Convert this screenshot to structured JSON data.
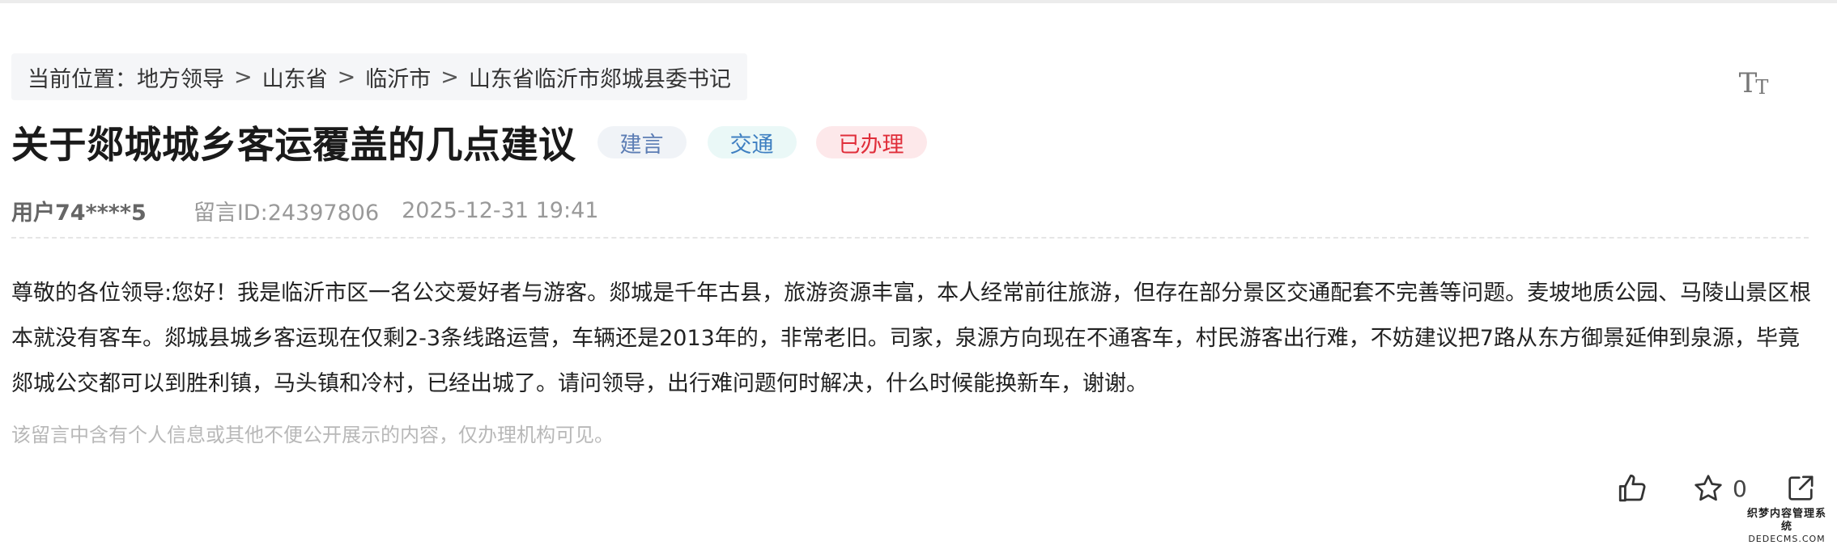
{
  "breadcrumb": {
    "prefix": "当前位置：",
    "items": [
      "地方领导",
      "山东省",
      "临沂市",
      "山东省临沂市郯城县委书记"
    ],
    "separator": ">"
  },
  "toolbar": {
    "font_size_icon": "font-size-icon",
    "font_size_big": "T",
    "font_size_small": "T"
  },
  "message": {
    "title": "关于郯城城乡客运覆盖的几点建议",
    "tags": {
      "type": "建言",
      "category": "交通",
      "status": "已办理"
    },
    "user": "用户74****5",
    "id_label": "留言ID:24397806",
    "datetime": "2025-12-31 19:41",
    "content": "尊敬的各位领导:您好！我是临沂市区一名公交爱好者与游客。郯城是千年古县，旅游资源丰富，本人经常前往旅游，但存在部分景区交通配套不完善等问题。麦坡地质公园、马陵山景区根本就没有客车。郯城县城乡客运现在仅剩2-3条线路运营，车辆还是2013年的，非常老旧。司家，泉源方向现在不通客车，村民游客出行难，不妨建议把7路从东方御景延伸到泉源，毕竟郯城公交都可以到胜利镇，马头镇和冷村，已经出城了。请问领导，出行难问题何时解决，什么时候能换新车，谢谢。",
    "privacy_notice": "该留言中含有个人信息或其他不便公开展示的内容，仅办理机构可见。"
  },
  "actions": {
    "like_icon": "thumbs-up-icon",
    "favorite_icon": "star-icon",
    "favorite_count": "0",
    "share_icon": "share-icon"
  },
  "watermark": {
    "line1": "织梦内容管理系统",
    "line2": "DEDECMS.COM"
  },
  "colors": {
    "tag_type_text": "#5c7db4",
    "tag_category_text": "#3e7fc1",
    "tag_status_text": "#e02e3a",
    "tag_status_bg": "#fde8ea"
  }
}
